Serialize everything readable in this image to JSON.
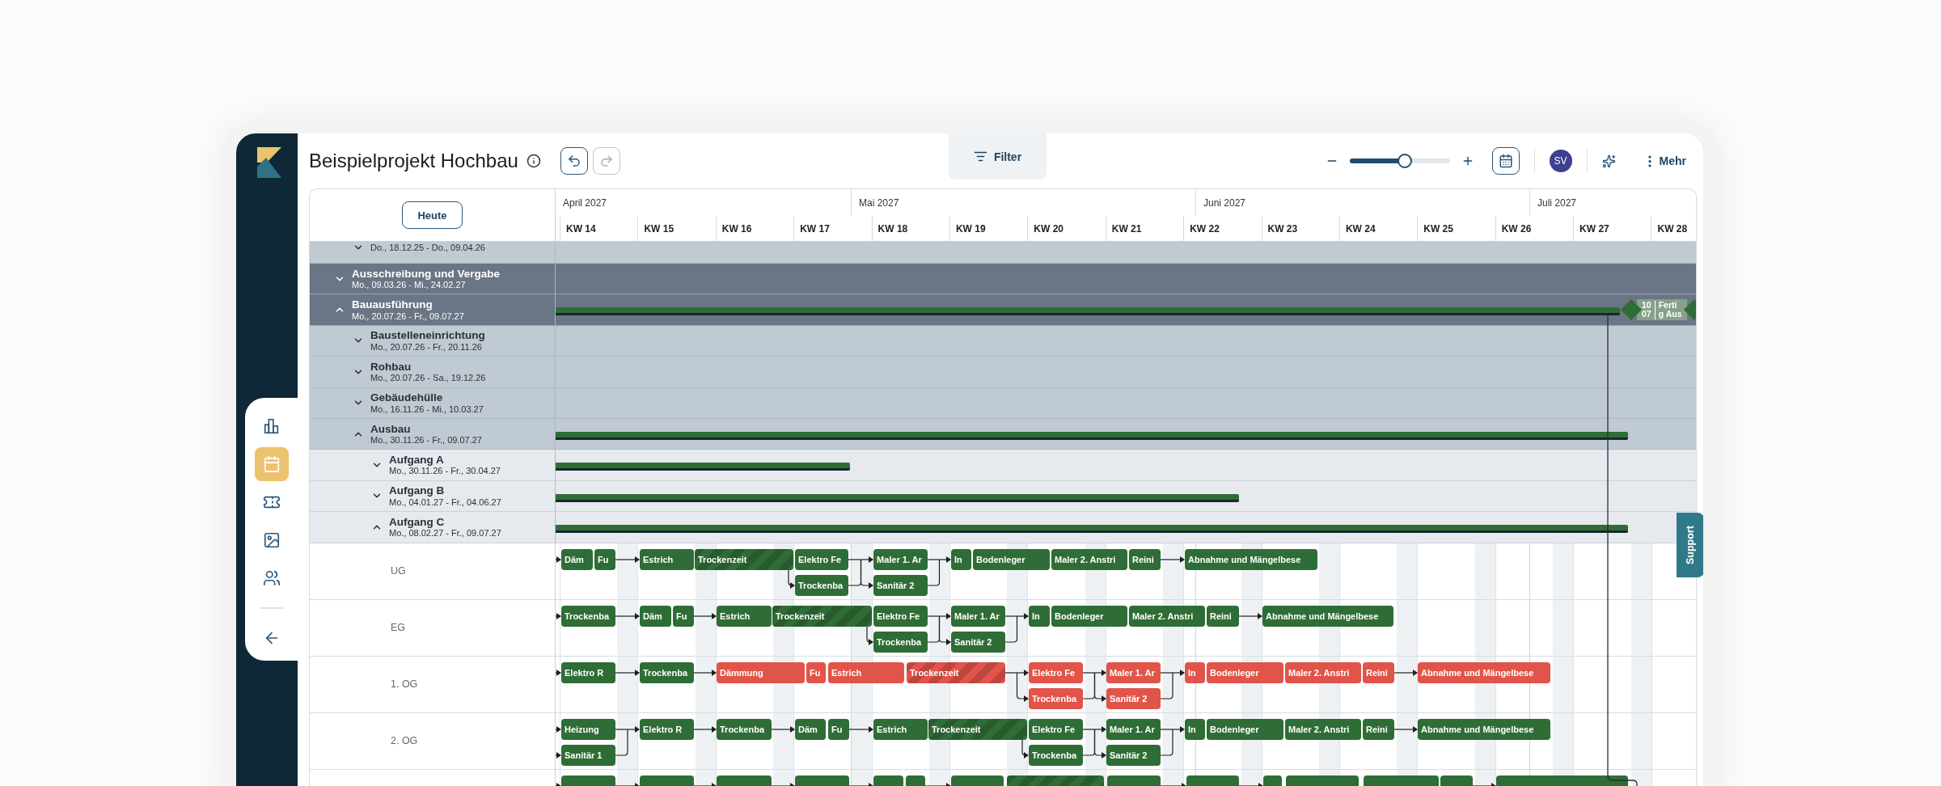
{
  "header": {
    "title": "Beispielprojekt Hochbau",
    "undo": {
      "disabled": false
    },
    "redo": {
      "disabled": true
    },
    "filter": "Filter",
    "zoom": {
      "level": 0.55
    },
    "avatar": "SV",
    "more": "Mehr"
  },
  "sidebar": {
    "items": [
      {
        "selected": false
      },
      {
        "selected": true
      },
      {
        "selected": false
      },
      {
        "selected": false
      },
      {
        "selected": false
      }
    ]
  },
  "support": "Support",
  "gantt": {
    "today": "Heute",
    "months": [
      "April 2027",
      "Mai 2027",
      "Juni 2027",
      "Juli 2027"
    ],
    "weeks": [
      "KW 14",
      "KW 15",
      "KW 16",
      "KW 17",
      "KW 18",
      "KW 19",
      "KW 20",
      "KW 21",
      "KW 22",
      "KW 23",
      "KW 24",
      "KW 25",
      "KW 26",
      "KW 27",
      "KW 28"
    ],
    "continued_rows": [
      {
        "dates": "Do., 18.12.25 - Do., 09.04.26",
        "expanded": false
      }
    ],
    "rows": [
      {
        "title": "Ausschreibung und Vergabe",
        "dates": "Mo., 09.03.26 - Mi., 24.02.27",
        "expanded": false
      },
      {
        "title": "Bauausführung",
        "dates": "Mo., 20.07.26 - Fr., 09.07.27",
        "expanded": true,
        "milestone": {
          "day": "10",
          "month": "07",
          "text": [
            "Ferti",
            "g Aus"
          ]
        },
        "children": [
          {
            "title": "Baustelleneinrichtung",
            "dates": "Mo., 20.07.26 - Fr., 20.11.26",
            "expanded": false
          },
          {
            "title": "Rohbau",
            "dates": "Mo., 20.07.26 - Sa., 19.12.26",
            "expanded": false
          },
          {
            "title": "Gebäudehülle",
            "dates": "Mo., 16.11.26 - Mi., 10.03.27",
            "expanded": false
          },
          {
            "title": "Ausbau",
            "dates": "Mo., 30.11.26 - Fr., 09.07.27",
            "expanded": true,
            "children": [
              {
                "title": "Aufgang A",
                "dates": "Mo., 30.11.26 - Fr., 30.04.27",
                "expanded": false
              },
              {
                "title": "Aufgang B",
                "dates": "Mo., 04.01.27 - Fr., 04.06.27",
                "expanded": false
              },
              {
                "title": "Aufgang C",
                "dates": "Mo., 08.02.27 - Fr., 09.07.27",
                "expanded": true,
                "children": [
                  {
                    "label": "UG",
                    "tasks": [
                      {
                        "label": "Däm",
                        "color": "#2f6d36",
                        "kind": "task"
                      },
                      {
                        "label": "Fu",
                        "color": "#2f6d36",
                        "kind": "task"
                      },
                      {
                        "label": "Estrich",
                        "color": "#2f6d36",
                        "kind": "task"
                      },
                      {
                        "label": "Trockenzeit",
                        "color": "#2f6d36",
                        "kind": "drying"
                      },
                      {
                        "label": "Elektro Fe",
                        "color": "#2f6d36",
                        "kind": "task"
                      },
                      {
                        "label": "Trockenba",
                        "color": "#2f6d36",
                        "kind": "task"
                      },
                      {
                        "label": "Maler 1. Ar",
                        "color": "#2f6d36",
                        "kind": "task"
                      },
                      {
                        "label": "Sanitär 2",
                        "color": "#2f6d36",
                        "kind": "task"
                      },
                      {
                        "label": "In",
                        "color": "#2f6d36",
                        "kind": "task"
                      },
                      {
                        "label": "Bodenleger",
                        "color": "#2f6d36",
                        "kind": "task"
                      },
                      {
                        "label": "Maler 2. Anstri",
                        "color": "#2f6d36",
                        "kind": "task"
                      },
                      {
                        "label": "Reini",
                        "color": "#2f6d36",
                        "kind": "task"
                      },
                      {
                        "label": "Abnahme und Mängelbese",
                        "color": "#2f6d36",
                        "kind": "task"
                      }
                    ]
                  },
                  {
                    "label": "EG",
                    "tasks": [
                      {
                        "label": "Trockenba",
                        "color": "#2f6d36",
                        "kind": "task"
                      },
                      {
                        "label": "Däm",
                        "color": "#2f6d36",
                        "kind": "task"
                      },
                      {
                        "label": "Fu",
                        "color": "#2f6d36",
                        "kind": "task"
                      },
                      {
                        "label": "Estrich",
                        "color": "#2f6d36",
                        "kind": "task"
                      },
                      {
                        "label": "Trockenzeit",
                        "color": "#2f6d36",
                        "kind": "drying"
                      },
                      {
                        "label": "Elektro Fe",
                        "color": "#2f6d36",
                        "kind": "task"
                      },
                      {
                        "label": "Trockenba",
                        "color": "#2f6d36",
                        "kind": "task"
                      },
                      {
                        "label": "Maler 1. Ar",
                        "color": "#2f6d36",
                        "kind": "task"
                      },
                      {
                        "label": "Sanitär 2",
                        "color": "#2f6d36",
                        "kind": "task"
                      },
                      {
                        "label": "In",
                        "color": "#2f6d36",
                        "kind": "task"
                      },
                      {
                        "label": "Bodenleger",
                        "color": "#2f6d36",
                        "kind": "task"
                      },
                      {
                        "label": "Maler 2. Anstri",
                        "color": "#2f6d36",
                        "kind": "task"
                      },
                      {
                        "label": "Reini",
                        "color": "#2f6d36",
                        "kind": "task"
                      },
                      {
                        "label": "Abnahme und Mängelbese",
                        "color": "#2f6d36",
                        "kind": "task"
                      }
                    ]
                  },
                  {
                    "label": "1. OG",
                    "tasks": [
                      {
                        "label": "Elektro R",
                        "color": "#2f6d36",
                        "kind": "task"
                      },
                      {
                        "label": "Trockenba",
                        "color": "#2f6d36",
                        "kind": "task"
                      },
                      {
                        "label": "Dämmung",
                        "color": "#e1544a",
                        "kind": "task"
                      },
                      {
                        "label": "Fu",
                        "color": "#e1544a",
                        "kind": "task"
                      },
                      {
                        "label": "Estrich",
                        "color": "#e1544a",
                        "kind": "task"
                      },
                      {
                        "label": "Trockenzeit",
                        "color": "#e1544a",
                        "kind": "drying"
                      },
                      {
                        "label": "Elektro Fe",
                        "color": "#e1544a",
                        "kind": "task"
                      },
                      {
                        "label": "Trockenba",
                        "color": "#e1544a",
                        "kind": "task"
                      },
                      {
                        "label": "Maler 1. Ar",
                        "color": "#e1544a",
                        "kind": "task"
                      },
                      {
                        "label": "Sanitär 2",
                        "color": "#e1544a",
                        "kind": "task"
                      },
                      {
                        "label": "In",
                        "color": "#e1544a",
                        "kind": "task"
                      },
                      {
                        "label": "Bodenleger",
                        "color": "#e1544a",
                        "kind": "task"
                      },
                      {
                        "label": "Maler 2. Anstri",
                        "color": "#e1544a",
                        "kind": "task"
                      },
                      {
                        "label": "Reini",
                        "color": "#e1544a",
                        "kind": "task"
                      },
                      {
                        "label": "Abnahme und Mängelbese",
                        "color": "#e1544a",
                        "kind": "task"
                      }
                    ]
                  },
                  {
                    "label": "2. OG",
                    "tasks": [
                      {
                        "label": "Heizung",
                        "color": "#2f6d36",
                        "kind": "task"
                      },
                      {
                        "label": "Sanitär 1",
                        "color": "#2f6d36",
                        "kind": "task"
                      },
                      {
                        "label": "Elektro R",
                        "color": "#2f6d36",
                        "kind": "task"
                      },
                      {
                        "label": "Trockenba",
                        "color": "#2f6d36",
                        "kind": "task"
                      },
                      {
                        "label": "Däm",
                        "color": "#2f6d36",
                        "kind": "task"
                      },
                      {
                        "label": "Fu",
                        "color": "#2f6d36",
                        "kind": "task"
                      },
                      {
                        "label": "Estrich",
                        "color": "#2f6d36",
                        "kind": "task"
                      },
                      {
                        "label": "Trockenzeit",
                        "color": "#2f6d36",
                        "kind": "drying"
                      },
                      {
                        "label": "Elektro Fe",
                        "color": "#2f6d36",
                        "kind": "task"
                      },
                      {
                        "label": "Trockenba",
                        "color": "#2f6d36",
                        "kind": "task"
                      },
                      {
                        "label": "Maler 1. Ar",
                        "color": "#2f6d36",
                        "kind": "task"
                      },
                      {
                        "label": "Sanitär 2",
                        "color": "#2f6d36",
                        "kind": "task"
                      },
                      {
                        "label": "In",
                        "color": "#2f6d36",
                        "kind": "task"
                      },
                      {
                        "label": "Bodenleger",
                        "color": "#2f6d36",
                        "kind": "task"
                      },
                      {
                        "label": "Maler 2. Anstri",
                        "color": "#2f6d36",
                        "kind": "task"
                      },
                      {
                        "label": "Reini",
                        "color": "#2f6d36",
                        "kind": "task"
                      },
                      {
                        "label": "Abnahme und Mängelbese",
                        "color": "#2f6d36",
                        "kind": "task"
                      }
                    ]
                  },
                  {
                    "tasks": [
                      {
                        "color": "#2f6d36",
                        "kind": "task"
                      },
                      {
                        "color": "#2f6d36",
                        "kind": "task"
                      },
                      {
                        "color": "#2f6d36",
                        "kind": "task"
                      },
                      {
                        "color": "#2f6d36",
                        "kind": "task"
                      },
                      {
                        "color": "#2f6d36",
                        "kind": "task"
                      },
                      {
                        "color": "#2f6d36",
                        "kind": "task"
                      },
                      {
                        "color": "#2f6d36",
                        "kind": "task"
                      },
                      {
                        "color": "#2f6d36",
                        "kind": "drying"
                      },
                      {
                        "color": "#2f6d36",
                        "kind": "task"
                      },
                      {
                        "color": "#2f6d36",
                        "kind": "task"
                      },
                      {
                        "color": "#2f6d36",
                        "kind": "task"
                      },
                      {
                        "color": "#2f6d36",
                        "kind": "task"
                      },
                      {
                        "color": "#2f6d36",
                        "kind": "task"
                      },
                      {
                        "color": "#2f6d36",
                        "kind": "task"
                      },
                      {
                        "color": "#2f6d36",
                        "kind": "task"
                      }
                    ]
                  }
                ]
              }
            ]
          }
        ]
      }
    ]
  }
}
